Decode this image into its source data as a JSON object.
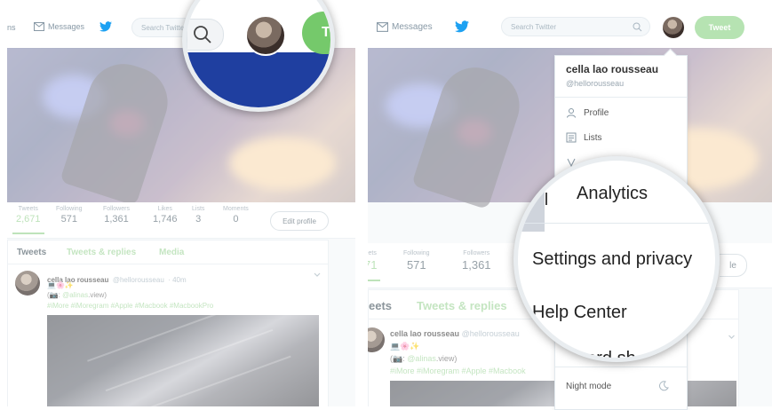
{
  "left_panel": {
    "nav": {
      "moments_fragment": "ns",
      "messages_label": "Messages",
      "search_placeholder": "Search Twitter"
    },
    "stats": [
      {
        "label": "Tweets",
        "value": "2,671"
      },
      {
        "label": "Following",
        "value": "571"
      },
      {
        "label": "Followers",
        "value": "1,361"
      },
      {
        "label": "Likes",
        "value": "1,746"
      },
      {
        "label": "Lists",
        "value": "3"
      },
      {
        "label": "Moments",
        "value": "0"
      }
    ],
    "edit_profile_label": "Edit profile",
    "tabs": [
      "Tweets",
      "Tweets & replies",
      "Media"
    ],
    "tweet": {
      "name": "cella lao rousseau",
      "handle": "@hellorousseau",
      "time": "· 40m",
      "emoji_line": "💻🌸✨",
      "mention_prefix": "(📷: ",
      "mention": "@alinas",
      "mention_suffix": ".view)",
      "hashtags": "#iMore #iMoregram #Apple #Macbook #MacbookPro"
    },
    "magnifier": {
      "tweet_fragment": "Tw"
    }
  },
  "right_panel": {
    "nav": {
      "messages_label": "Messages",
      "search_placeholder": "Search Twitter",
      "tweet_label": "Tweet"
    },
    "stats": [
      {
        "label": "eets",
        "value": "71"
      },
      {
        "label": "Following",
        "value": "571"
      },
      {
        "label": "Followers",
        "value": "1,361"
      }
    ],
    "edit_profile_fragment": "le",
    "tabs": [
      "eets",
      "Tweets & replies"
    ],
    "tweet": {
      "name": "cella lao rousseau",
      "handle": "@hellorousseau",
      "emoji_line": "💻🌸✨",
      "mention_prefix": "(📷: ",
      "mention": "@alinas",
      "mention_suffix": ".view)",
      "hashtags": "#iMore #iMoregram #Apple #Macbook"
    },
    "dropdown": {
      "name": "cella lao rousseau",
      "handle": "@hellorousseau",
      "items": [
        "Profile",
        "Lists"
      ],
      "night_mode": "Night mode"
    },
    "magnifier": {
      "items": [
        "Analytics",
        "Settings and privacy",
        "Help Center"
      ],
      "partial_item": "oard sh"
    }
  },
  "colors": {
    "brand_green": "#9fd69a",
    "twitter_blue": "#1da1f2",
    "text_gray": "#66757f"
  }
}
